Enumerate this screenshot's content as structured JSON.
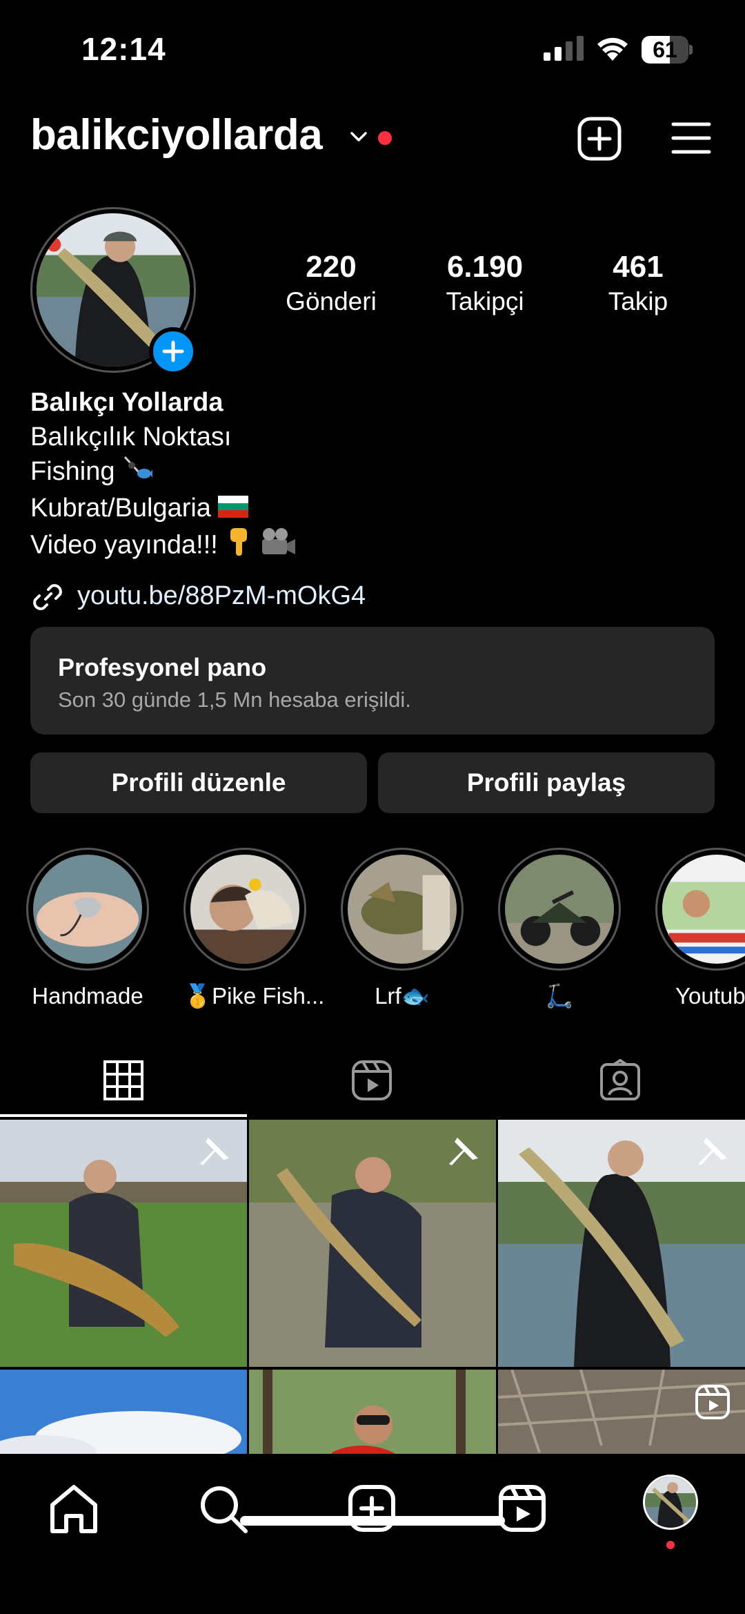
{
  "status_bar": {
    "time": "12:14",
    "battery_level": "61",
    "battery_fraction": 0.61
  },
  "header": {
    "username": "balikciyollarda"
  },
  "stats": [
    {
      "value": "220",
      "label": "Gönderi"
    },
    {
      "value": "6.190",
      "label": "Takipçi"
    },
    {
      "value": "461",
      "label": "Takip"
    }
  ],
  "bio": {
    "name": "Balıkçı Yollarda",
    "lines": [
      "Balıkçılık Noktası",
      "Fishing",
      "Kubrat/Bulgaria",
      "Video yayında!!!"
    ],
    "link": "youtu.be/88PzM-mOkG4"
  },
  "pro_panel": {
    "title": "Profesyonel pano",
    "subtitle": "Son 30 günde 1,5 Mn hesaba erişildi."
  },
  "buttons": {
    "edit": "Profili düzenle",
    "share": "Profili paylaş"
  },
  "highlights": [
    {
      "label": "Handmade"
    },
    {
      "label": "🥇Pike Fish..."
    },
    {
      "label": "Lrf🐟"
    },
    {
      "label": "🛴"
    },
    {
      "label": "Youtube"
    }
  ],
  "tabs": [
    "grid-icon",
    "reels-icon",
    "tagged-icon"
  ],
  "colors": {
    "accent": "#0095f6",
    "notification": "#ff3040",
    "panel": "#262626"
  }
}
